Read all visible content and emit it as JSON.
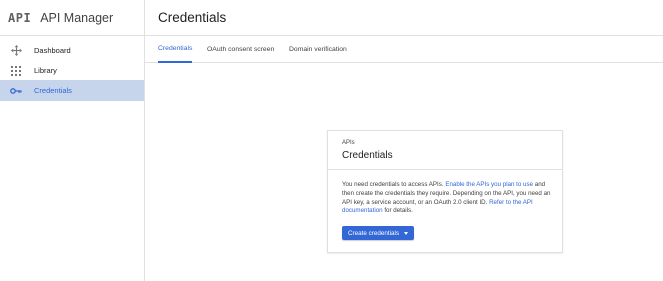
{
  "header": {
    "logo_text": "API",
    "app_title": "API Manager",
    "page_title": "Credentials"
  },
  "sidebar": {
    "items": [
      {
        "label": "Dashboard",
        "icon": "dashboard-icon",
        "active": false
      },
      {
        "label": "Library",
        "icon": "library-icon",
        "active": false
      },
      {
        "label": "Credentials",
        "icon": "key-icon",
        "active": true
      }
    ]
  },
  "tabs": [
    {
      "label": "Credentials",
      "active": true
    },
    {
      "label": "OAuth consent screen",
      "active": false
    },
    {
      "label": "Domain verification",
      "active": false
    }
  ],
  "card": {
    "eyebrow": "APIs",
    "title": "Credentials",
    "body_text_1": "You need credentials to access APIs. ",
    "link_enable": "Enable the APIs you plan to use",
    "body_text_2": " and then create the credentials they require. Depending on the API, you need an API key, a service account, or an OAuth 2.0 client ID. ",
    "link_docs": "Refer to the API documentation",
    "body_text_3": " for details.",
    "create_button": "Create credentials"
  },
  "colors": {
    "accent": "#3367d6",
    "active_nav_bg": "#c6d5ec",
    "border": "#e0e0e0"
  }
}
